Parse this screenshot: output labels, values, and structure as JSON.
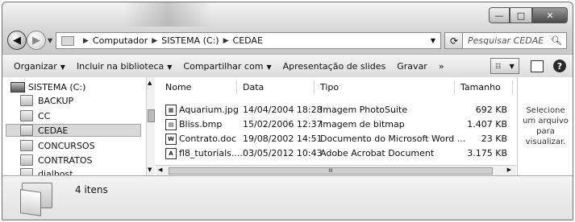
{
  "window": {
    "controls": {
      "minimize": "—",
      "maximize": "□",
      "close": "✕"
    }
  },
  "nav": {
    "back": "◀",
    "forward": "▶"
  },
  "address": {
    "crumbs": [
      "Computador",
      "SISTEMA (C:)",
      "CEDAE"
    ],
    "refresh": "⟳"
  },
  "search": {
    "placeholder": "Pesquisar CEDAE",
    "icon": "search-icon"
  },
  "toolbar": {
    "organize": "Organizar",
    "include_library": "Incluir na biblioteca",
    "share": "Compartilhar com",
    "slideshow": "Apresentação de slides",
    "burn": "Gravar",
    "more": "»",
    "help": "?"
  },
  "tree": {
    "root": "SISTEMA (C:)",
    "items": [
      "BACKUP",
      "CC",
      "CEDAE",
      "CONCURSOS",
      "CONTRATOS",
      "dialhost"
    ],
    "selected": "CEDAE"
  },
  "files": {
    "columns": {
      "name": "Nome",
      "date": "Data",
      "type": "Tipo",
      "size": "Tamanho"
    },
    "rows": [
      {
        "name": "Aquarium.jpg",
        "date": "14/04/2004 18:28",
        "type": "Imagem PhotoSuite",
        "size": "692 KB",
        "icon": "image-file-icon"
      },
      {
        "name": "Bliss.bmp",
        "date": "15/02/2006 12:37",
        "type": "Imagem de bitmap",
        "size": "1.407 KB",
        "icon": "bitmap-file-icon"
      },
      {
        "name": "Contrato.doc",
        "date": "19/08/2002 14:51",
        "type": "Documento do Microsoft Word ...",
        "size": "23 KB",
        "icon": "word-file-icon"
      },
      {
        "name": "fl8_tutorials....",
        "date": "03/05/2012 10:43",
        "type": "Adobe Acrobat Document",
        "size": "3.175 KB",
        "icon": "pdf-file-icon"
      }
    ],
    "hscroll_grip": "III"
  },
  "preview": {
    "text": "Selecione um arquivo para visualizar."
  },
  "details": {
    "count": "4 itens"
  }
}
